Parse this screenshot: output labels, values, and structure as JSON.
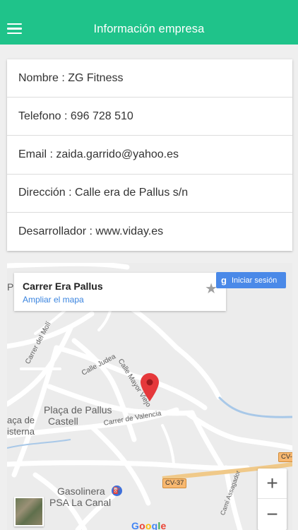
{
  "header": {
    "title": "Información empresa"
  },
  "company": {
    "rows": [
      "Nombre : ZG Fitness",
      "Telefono : 696 728 510",
      "Email : zaida.garrido@yahoo.es",
      "Dirección : Calle era de Pallus s/n",
      "Desarrollador : www.viday.es"
    ]
  },
  "map": {
    "place_name": "Carrer Era Pallus",
    "expand_link": "Ampliar el mapa",
    "signin_label": "Iniciar sesión",
    "zoom_in": "+",
    "zoom_out": "−",
    "logo": "Google",
    "labels": {
      "carrer_moli": "Carrer del Molí",
      "calle_judea": "Calle Judea",
      "calle_mayor": "Calle Mayor Viejo",
      "placa_pallus": "Plaça de Pallus",
      "placa_castell": "Castell",
      "placa_cisterna_1": "aça de",
      "placa_cisterna_2": "isterna",
      "carrer_valencia": "Carrer de Valencia",
      "gasolinera_1": "Gasolinera",
      "gasolinera_2": "PSA La Canal",
      "cami_assagador": "Camí Assagador",
      "p_letter": "P"
    },
    "shields": {
      "cv37": "CV-37",
      "cv_right": "CV-"
    },
    "colors": {
      "pin": "#e5383b",
      "accent": "#1fc38a",
      "signin": "#4a89e8"
    }
  }
}
